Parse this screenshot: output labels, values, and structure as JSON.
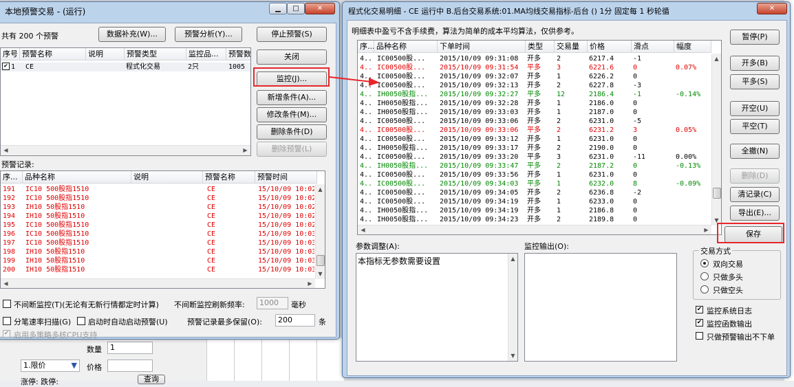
{
  "left_window": {
    "title": "本地预警交易 - (运行)",
    "count_text": "共有 200 个预警",
    "buttons": {
      "data_fill": "数据补充(W)...",
      "analysis": "预警分析(Y)...",
      "stop": "停止预警(S)",
      "close": "关闭",
      "monitor": "监控(J)...",
      "add_cond": "新增条件(A)...",
      "edit_cond": "修改条件(M)...",
      "del_cond": "删除条件(D)",
      "del_alert": "删除预警(L)"
    },
    "alert_table": {
      "columns": [
        "序号",
        "预警名称",
        "说明",
        "预警类型",
        "监控品...",
        "预警数"
      ],
      "rows": [
        {
          "no": "1",
          "checked": "✔",
          "name": "CE",
          "desc": "",
          "type": "程式化交易",
          "items": "2只",
          "count": "1005"
        }
      ]
    },
    "records_label": "预警记录:",
    "records_table": {
      "columns": [
        "序...",
        "品种名称",
        "说明",
        "预警名称",
        "预警时间"
      ],
      "rows": [
        {
          "no": "191",
          "name": "IC10 500股指1510",
          "desc": "",
          "alert": "CE",
          "time": "15/10/09 10:02"
        },
        {
          "no": "192",
          "name": "IC10 500股指1510",
          "desc": "",
          "alert": "CE",
          "time": "15/10/09 10:02"
        },
        {
          "no": "193",
          "name": "IH10 50股指1510",
          "desc": "",
          "alert": "CE",
          "time": "15/10/09 10:02"
        },
        {
          "no": "194",
          "name": "IH10 50股指1510",
          "desc": "",
          "alert": "CE",
          "time": "15/10/09 10:02"
        },
        {
          "no": "195",
          "name": "IC10 500股指1510",
          "desc": "",
          "alert": "CE",
          "time": "15/10/09 10:02"
        },
        {
          "no": "196",
          "name": "IC10 500股指1510",
          "desc": "",
          "alert": "CE",
          "time": "15/10/09 10:03"
        },
        {
          "no": "197",
          "name": "IC10 500股指1510",
          "desc": "",
          "alert": "CE",
          "time": "15/10/09 10:03"
        },
        {
          "no": "198",
          "name": "IH10 50股指1510",
          "desc": "",
          "alert": "CE",
          "time": "15/10/09 10:03"
        },
        {
          "no": "199",
          "name": "IH10 50股指1510",
          "desc": "",
          "alert": "CE",
          "time": "15/10/09 10:03"
        },
        {
          "no": "200",
          "name": "IH10 50股指1510",
          "desc": "",
          "alert": "CE",
          "time": "15/10/09 10:03"
        }
      ]
    },
    "options": {
      "continuous": "不间断监控(T)(无论有无新行情都定时计算)",
      "refresh_label": "不间断监控刷新频率:",
      "refresh_value": "1000",
      "refresh_unit": "毫秒",
      "tick_scan": "分笔速率扫描(G)",
      "auto_start": "启动时自动启动预警(U)",
      "max_keep_label": "预警记录最多保留(O):",
      "max_keep_value": "200",
      "max_keep_unit": "条",
      "multicore": "启用多策略多核CPU支持"
    }
  },
  "bg_app": {
    "qty_label": "数量",
    "qty_value": "1",
    "order_type": "1.限价",
    "price_label": "价格",
    "rise_fall": "涨停: 跌停:",
    "query_button": "查询"
  },
  "right_window": {
    "title": "程式化交易明细 - CE 运行中 B.后台交易系统:01.MA均线交易指标-后台 () 1分 固定每 1 秒轮循",
    "note": "明细表中盈亏不含手续费，算法为简单的成本平均算法，仅供参考。",
    "columns": [
      "序...",
      "品种名称",
      "下单时间",
      "类型",
      "交易量",
      "价格",
      "滑点",
      "幅度"
    ],
    "rows": [
      {
        "no": "4..",
        "name": "IC00500股...",
        "time": "2015/10/09 09:31:08",
        "type": "开多",
        "qty": "2",
        "price": "6217.4",
        "slip": "-1",
        "pct": "",
        "color": "black"
      },
      {
        "no": "4..",
        "name": "IC00500股...",
        "time": "2015/10/09 09:31:54",
        "type": "平多",
        "qty": "3",
        "price": "6221.6",
        "slip": "0",
        "pct": "0.07%",
        "color": "red"
      },
      {
        "no": "4..",
        "name": "IC00500股...",
        "time": "2015/10/09 09:32:07",
        "type": "开多",
        "qty": "1",
        "price": "6226.2",
        "slip": "0",
        "pct": "",
        "color": "black"
      },
      {
        "no": "4..",
        "name": "IC00500股...",
        "time": "2015/10/09 09:32:13",
        "type": "开多",
        "qty": "2",
        "price": "6227.8",
        "slip": "-3",
        "pct": "",
        "color": "black"
      },
      {
        "no": "4..",
        "name": "IH0050股指...",
        "time": "2015/10/09 09:32:27",
        "type": "平多",
        "qty": "12",
        "price": "2186.4",
        "slip": "-1",
        "pct": "-0.14%",
        "color": "green"
      },
      {
        "no": "4..",
        "name": "IH0050股指...",
        "time": "2015/10/09 09:32:28",
        "type": "开多",
        "qty": "1",
        "price": "2186.0",
        "slip": "0",
        "pct": "",
        "color": "black"
      },
      {
        "no": "4..",
        "name": "IH0050股指...",
        "time": "2015/10/09 09:33:03",
        "type": "开多",
        "qty": "1",
        "price": "2187.0",
        "slip": "0",
        "pct": "",
        "color": "black"
      },
      {
        "no": "4..",
        "name": "IC00500股...",
        "time": "2015/10/09 09:33:06",
        "type": "开多",
        "qty": "2",
        "price": "6231.0",
        "slip": "-5",
        "pct": "",
        "color": "black"
      },
      {
        "no": "4..",
        "name": "IC00500股...",
        "time": "2015/10/09 09:33:06",
        "type": "平多",
        "qty": "2",
        "price": "6231.2",
        "slip": "3",
        "pct": "0.05%",
        "color": "red"
      },
      {
        "no": "4..",
        "name": "IC00500股...",
        "time": "2015/10/09 09:33:12",
        "type": "开多",
        "qty": "1",
        "price": "6231.0",
        "slip": "0",
        "pct": "",
        "color": "black"
      },
      {
        "no": "4..",
        "name": "IH0050股指...",
        "time": "2015/10/09 09:33:17",
        "type": "开多",
        "qty": "2",
        "price": "2190.0",
        "slip": "0",
        "pct": "",
        "color": "black"
      },
      {
        "no": "4..",
        "name": "IC00500股...",
        "time": "2015/10/09 09:33:20",
        "type": "平多",
        "qty": "3",
        "price": "6231.0",
        "slip": "-11",
        "pct": "0.00%",
        "color": "black"
      },
      {
        "no": "4..",
        "name": "IH0050股指...",
        "time": "2015/10/09 09:33:47",
        "type": "平多",
        "qty": "2",
        "price": "2187.2",
        "slip": "0",
        "pct": "-0.13%",
        "color": "green"
      },
      {
        "no": "4..",
        "name": "IC00500股...",
        "time": "2015/10/09 09:33:56",
        "type": "开多",
        "qty": "1",
        "price": "6231.0",
        "slip": "0",
        "pct": "",
        "color": "black"
      },
      {
        "no": "4..",
        "name": "IC00500股...",
        "time": "2015/10/09 09:34:03",
        "type": "平多",
        "qty": "1",
        "price": "6232.0",
        "slip": "8",
        "pct": "-0.09%",
        "color": "green"
      },
      {
        "no": "4..",
        "name": "IC00500股...",
        "time": "2015/10/09 09:34:05",
        "type": "开多",
        "qty": "2",
        "price": "6236.8",
        "slip": "-2",
        "pct": "",
        "color": "black"
      },
      {
        "no": "4..",
        "name": "IC00500股...",
        "time": "2015/10/09 09:34:19",
        "type": "开多",
        "qty": "1",
        "price": "6233.0",
        "slip": "0",
        "pct": "",
        "color": "black"
      },
      {
        "no": "4..",
        "name": "IH0050股指...",
        "time": "2015/10/09 09:34:19",
        "type": "开多",
        "qty": "1",
        "price": "2186.8",
        "slip": "0",
        "pct": "",
        "color": "black"
      },
      {
        "no": "4..",
        "name": "IH0050股指...",
        "time": "2015/10/09 09:34:23",
        "type": "开多",
        "qty": "2",
        "price": "2189.8",
        "slip": "0",
        "pct": "",
        "color": "black"
      }
    ],
    "buttons": {
      "pause": "暂停(P)",
      "open_long": "开多(B)",
      "close_long": "平多(S)",
      "open_short": "开空(U)",
      "close_short": "平空(T)",
      "close_all": "全撤(N)",
      "delete": "删除(D)",
      "clear": "清记录(C)",
      "export": "导出(E)...",
      "save": "保存"
    },
    "param_label": "参数调整(A):",
    "param_text": "本指标无参数需要设置",
    "output_label": "监控输出(O):",
    "trade_mode": {
      "label": "交易方式",
      "options": [
        "双向交易",
        "只做多头",
        "只做空头"
      ],
      "selected": 0
    },
    "checks": {
      "log": "监控系统日志",
      "func_output": "监控函数输出",
      "alert_only": "只做预警输出不下单"
    }
  },
  "colors": {
    "red_text": "#e00000",
    "green_text": "#008800",
    "highlight": "#e8262a"
  }
}
